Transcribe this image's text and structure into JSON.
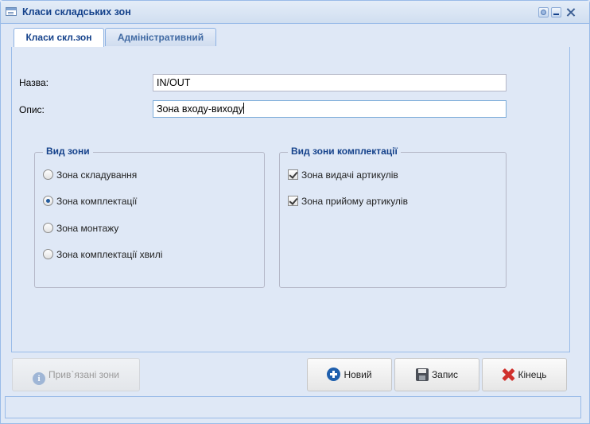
{
  "window": {
    "title": "Класи складських зон"
  },
  "tabs": [
    {
      "label": "Класи скл.зон",
      "active": true
    },
    {
      "label": "Адміністративний",
      "active": false
    }
  ],
  "form": {
    "name_label": "Назва:",
    "name_value": "IN/OUT",
    "desc_label": "Опис:",
    "desc_value": "Зона входу-виходу"
  },
  "zone_type": {
    "legend": "Вид зони",
    "options": [
      {
        "label": "Зона складування",
        "checked": false
      },
      {
        "label": "Зона комплектації",
        "checked": true
      },
      {
        "label": "Зона монтажу",
        "checked": false
      },
      {
        "label": "Зона комплектації хвилі",
        "checked": false
      }
    ]
  },
  "picking_zone_type": {
    "legend": "Вид зони комплектації",
    "options": [
      {
        "label": "Зона видачі артикулів",
        "checked": true
      },
      {
        "label": "Зона прийому артикулів",
        "checked": true
      }
    ]
  },
  "buttons": {
    "linked_zones": "Прив`язані зони",
    "new": "Новий",
    "save": "Запис",
    "end": "Кінець"
  }
}
